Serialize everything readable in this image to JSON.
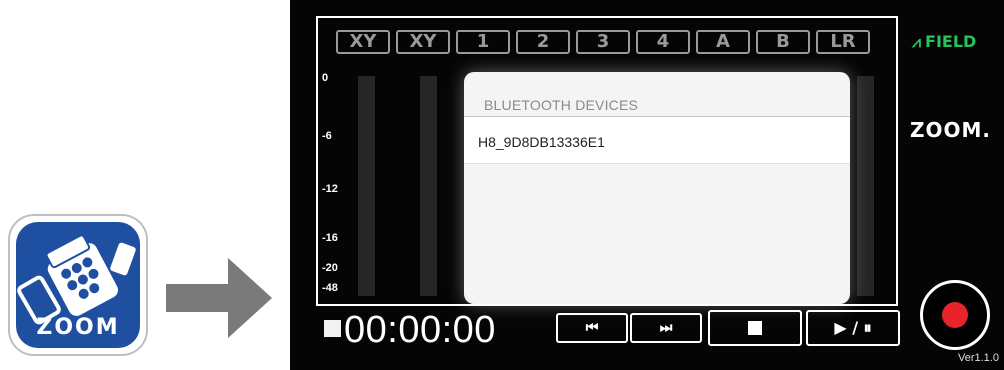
{
  "app_icon": {
    "logo_text": "ZOOM",
    "background": "#1f4fa0"
  },
  "arrow_color": "#7a7a7a",
  "tracks": [
    "XY",
    "XY",
    "1",
    "2",
    "3",
    "4",
    "A",
    "B",
    "LR"
  ],
  "scale": [
    "0",
    "-6",
    "-12",
    "-16",
    "-20",
    "-48"
  ],
  "brand": {
    "field_logo": "FIELD",
    "field_color": "#27c45a",
    "zoom_logo": "ZOOM."
  },
  "dialog": {
    "title": "BLUETOOTH DEVICES",
    "devices": [
      {
        "name": "H8_9D8DB13336E1"
      }
    ]
  },
  "transport": {
    "timecode": "00:00:00",
    "play_pause_label": "▶ / ⏸"
  },
  "record_color": "#e8232b",
  "version": "Ver1.1.0"
}
